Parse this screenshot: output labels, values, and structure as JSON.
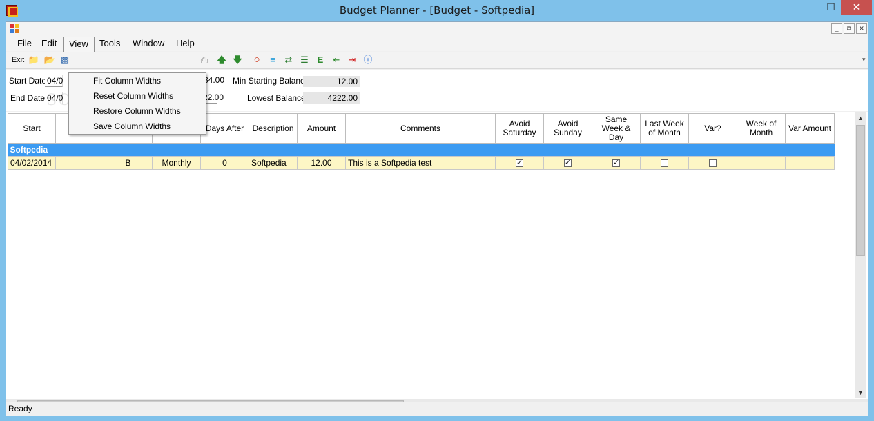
{
  "window": {
    "title": "Budget Planner - [Budget - Softpedia]"
  },
  "menubar": {
    "items": [
      "File",
      "Edit",
      "View",
      "Tools",
      "Window",
      "Help"
    ]
  },
  "toolbar": {
    "exit_label": "Exit",
    "e_label": "E"
  },
  "view_menu": {
    "items": [
      "Fit Column Widths",
      "Reset Column Widths",
      "Restore Column Widths",
      "Save Column Widths"
    ]
  },
  "form": {
    "start_date_label": "Start Date",
    "start_date_value": "04/0",
    "end_date_label": "End Date",
    "end_date_value": "04/0",
    "partial_value_1": "34.00",
    "partial_value_2": "22.00",
    "min_balance_label": "Min Starting Balance",
    "min_balance_value": "12.00",
    "lowest_balance_label": "Lowest Balance",
    "lowest_balance_value": "4222.00"
  },
  "watermark": "SOFTPEDIA",
  "grid": {
    "columns": [
      "Start",
      "End",
      "Type",
      "How Often",
      "Days After",
      "Description",
      "Amount",
      "Comments",
      "Avoid Saturday",
      "Avoid Sunday",
      "Same Week & Day",
      "Last Week of Month",
      "Var?",
      "Week of Month",
      "Var Amount"
    ],
    "group": "Softpedia",
    "row": {
      "start": "04/02/2014",
      "end": "",
      "type": "B",
      "how_often": "Monthly",
      "days_after": "0",
      "description": "Softpedia",
      "amount": "12.00",
      "comments": "This is a Softpedia test",
      "avoid_saturday": true,
      "avoid_sunday": true,
      "same_week_day": true,
      "last_week_of_month": false,
      "var": false,
      "week_of_month": "",
      "var_amount": ""
    }
  },
  "status": {
    "text": "Ready"
  },
  "colors": {
    "titlebar": "#7fc1ea",
    "group_row": "#3c9bf2",
    "data_row": "#fdf6c5",
    "close_button": "#c7514f"
  }
}
